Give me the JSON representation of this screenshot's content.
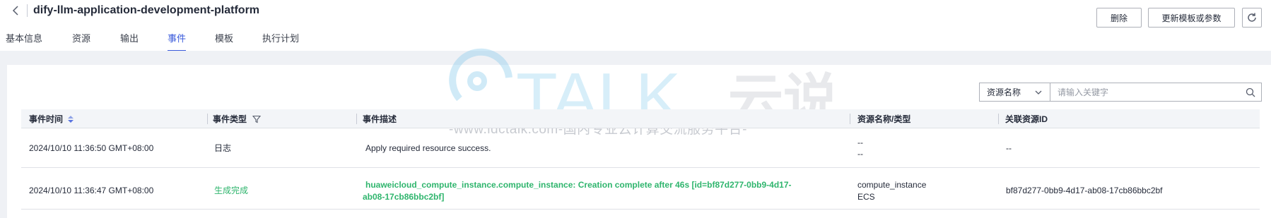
{
  "header": {
    "title": "dify-llm-application-development-platform",
    "actions": {
      "delete": "删除",
      "update": "更新模板或参数"
    }
  },
  "tabs": [
    {
      "label": "基本信息"
    },
    {
      "label": "资源"
    },
    {
      "label": "输出"
    },
    {
      "label": "事件",
      "active": true
    },
    {
      "label": "模板"
    },
    {
      "label": "执行计划"
    }
  ],
  "filter": {
    "field": "资源名称",
    "placeholder": "请输入关键字"
  },
  "table": {
    "columns": [
      "事件时间",
      "事件类型",
      "事件描述",
      "资源名称/类型",
      "关联资源ID"
    ],
    "rows": [
      {
        "time": "2024/10/10 11:36:50 GMT+08:00",
        "type": "日志",
        "description": "Apply required resource success.",
        "resource_name": "--",
        "resource_type": "--",
        "resource_id": "--"
      },
      {
        "time": "2024/10/10 11:36:47 GMT+08:00",
        "type": "生成完成",
        "description_line1": "huaweicloud_compute_instance.compute_instance: Creation complete after 46s [id=bf87d277-0bb9-4d17-",
        "description_line2": "ab08-17cb86bbc2bf]",
        "resource_name": "compute_instance",
        "resource_type": "ECS",
        "resource_id": "bf87d277-0bb9-4d17-ab08-17cb86bbc2bf"
      }
    ]
  },
  "watermark": {
    "logo_text": "TALK",
    "logo_cn": "云说",
    "tagline": "-www.idctalk.com-国内专业云计算交流服务平台-"
  },
  "colors": {
    "accent": "#3b5bdb",
    "success": "#2fb56d",
    "page_bg": "#eff1f5"
  },
  "icons": [
    "back-chevron-icon",
    "refresh-icon",
    "sort-icon",
    "filter-icon",
    "chevron-down-icon",
    "search-icon"
  ]
}
